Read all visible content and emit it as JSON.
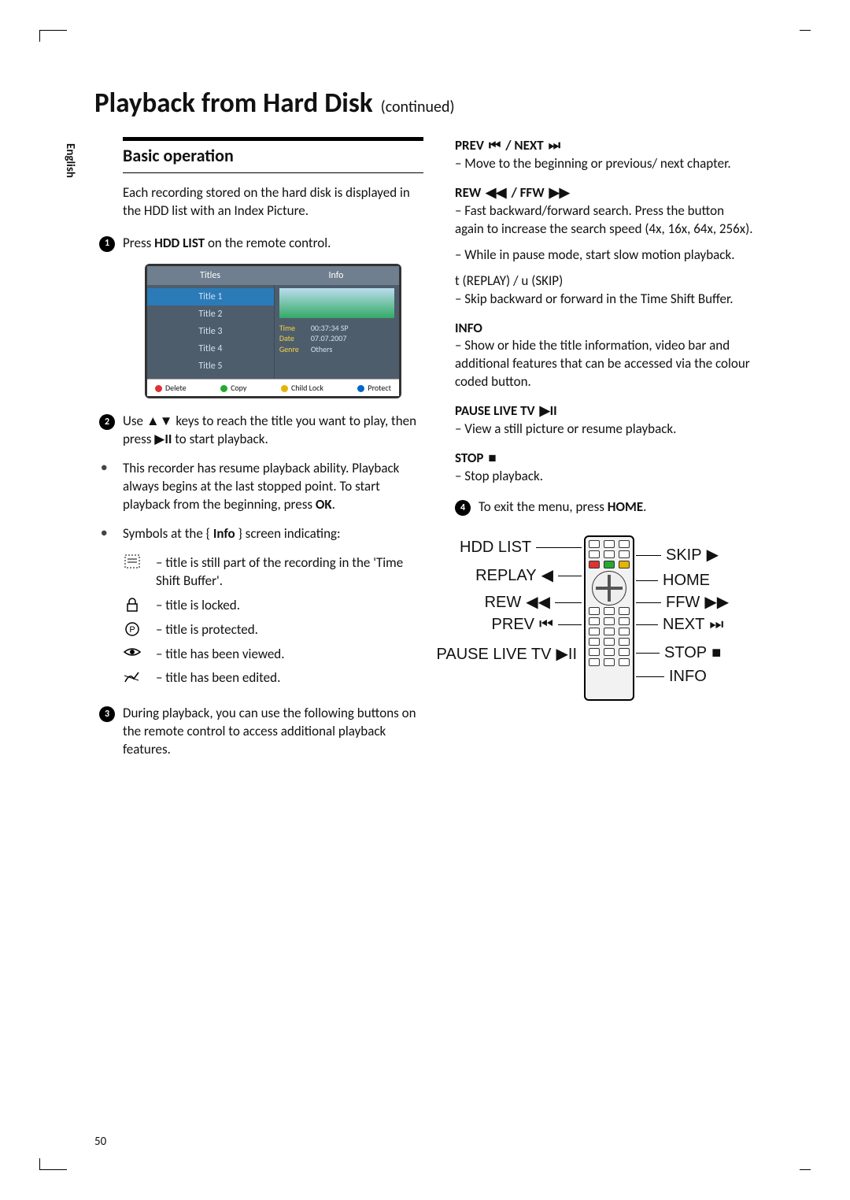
{
  "pageNumber": "50",
  "language": "English",
  "heading": {
    "main": "Playback from Hard Disk",
    "cont": "(continued)"
  },
  "left": {
    "sectionTitle": "Basic operation",
    "intro": "Each recording stored on the hard disk is displayed in the HDD list with an Index Picture.",
    "step1_pre": "Press ",
    "step1_bold": "HDD LIST",
    "step1_post": " on the remote control.",
    "step2_pre": "Use ",
    "step2_mid": " keys to reach the title you want to play, then press ",
    "step2_post": " to start playback.",
    "resume_pre": "This recorder has resume playback ability.  Playback always begins at the last stopped point.  To start playback from the beginning, press ",
    "resume_bold": "OK",
    "resume_post": ".",
    "symbolsIntro_pre": "Symbols at the { ",
    "symbolsIntro_bold": "Info",
    "symbolsIntro_post": " } screen indicating:",
    "sym1": "– title is still part of the recording in the 'Time Shift Buffer'.",
    "sym2": "– title is locked.",
    "sym3": "– title is protected.",
    "sym4": "– title has been viewed.",
    "sym5": "– title has been edited.",
    "step3": "During playback, you can use the following buttons on the remote control to access additional playback features."
  },
  "hdd": {
    "colTitles": "Titles",
    "colInfo": "Info",
    "t1": "Title 1",
    "t2": "Title 2",
    "t3": "Title 3",
    "t4": "Title 4",
    "t5": "Title 5",
    "time_k": "Time",
    "time_v": "00:37:34  SP",
    "date_k": "Date",
    "date_v": "07.07.2007",
    "genre_k": "Genre",
    "genre_v": "Others",
    "f1": "Delete",
    "f2": "Copy",
    "f3": "Child Lock",
    "f4": "Protect"
  },
  "right": {
    "prevnext_label_a": "PREV ",
    "prevnext_label_b": " / NEXT ",
    "prevnext_desc": "–   Move to the beginning or previous/ next chapter.",
    "rewffw_label_a": "REW ",
    "rewffw_label_b": " / FFW ",
    "rewffw_desc1": "–   Fast backward/forward search.  Press the button again to increase the search speed (4x, 16x, 64x, 256x).",
    "rewffw_desc2": "–   While in pause mode, start slow motion playback.",
    "replayskip_label": "t (REPLAY) / u (SKIP)",
    "replayskip_desc": "–   Skip backward or forward in the Time Shift Buffer.",
    "info_label": "INFO",
    "info_desc": "–   Show or hide the title information, video bar and additional features that can be accessed via the colour coded button.",
    "pause_label": "PAUSE LIVE TV ",
    "pause_desc": "–   View a still picture or resume playback.",
    "stop_label": "STOP ",
    "stop_desc": "–   Stop playback.",
    "step4_pre": "To exit the menu, press ",
    "step4_bold": "HOME",
    "step4_post": "."
  },
  "remote": {
    "hddlist": "HDD LIST",
    "replay": "REPLAY",
    "rew": "REW",
    "prev": "PREV",
    "pauselive": "PAUSE LIVE TV",
    "skip": "SKIP",
    "home": "HOME",
    "ffw": "FFW",
    "next": "NEXT",
    "stop": "STOP",
    "info": "INFO"
  }
}
